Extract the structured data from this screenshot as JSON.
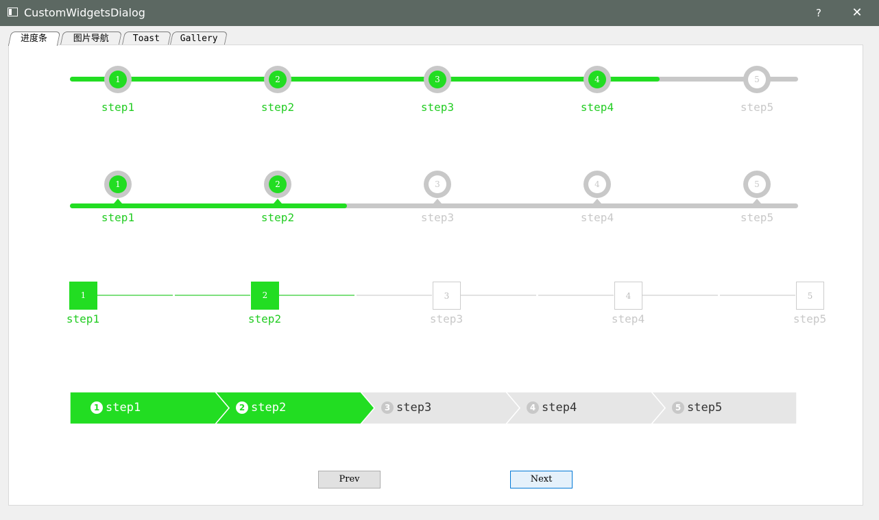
{
  "window": {
    "title": "CustomWidgetsDialog",
    "help_label": "?",
    "close_label": "✕"
  },
  "tabs": [
    {
      "label": "进度条",
      "active": true
    },
    {
      "label": "图片导航",
      "active": false
    },
    {
      "label": "Toast",
      "active": false
    },
    {
      "label": "Gallery",
      "active": false
    }
  ],
  "colors": {
    "active": "#22dd22",
    "inactive": "#c8c8c8"
  },
  "current_step": 4,
  "steppers": {
    "circle_top": {
      "progress": 0.81,
      "steps": [
        {
          "num": "1",
          "label": "step1",
          "done": true
        },
        {
          "num": "2",
          "label": "step2",
          "done": true
        },
        {
          "num": "3",
          "label": "step3",
          "done": true
        },
        {
          "num": "4",
          "label": "step4",
          "done": true
        },
        {
          "num": "5",
          "label": "step5",
          "done": false
        }
      ]
    },
    "circle_pointer": {
      "progress": 0.38,
      "steps": [
        {
          "num": "1",
          "label": "step1",
          "done": true
        },
        {
          "num": "2",
          "label": "step2",
          "done": true
        },
        {
          "num": "3",
          "label": "step3",
          "done": false
        },
        {
          "num": "4",
          "label": "step4",
          "done": false
        },
        {
          "num": "5",
          "label": "step5",
          "done": false
        }
      ]
    },
    "square": {
      "steps": [
        {
          "num": "1",
          "label": "step1",
          "done": true
        },
        {
          "num": "2",
          "label": "step2",
          "done": true
        },
        {
          "num": "3",
          "label": "step3",
          "done": false
        },
        {
          "num": "4",
          "label": "step4",
          "done": false
        },
        {
          "num": "5",
          "label": "step5",
          "done": false
        }
      ]
    },
    "arrow": {
      "steps": [
        {
          "num": "1",
          "label": "step1",
          "done": true
        },
        {
          "num": "2",
          "label": "step2",
          "done": true
        },
        {
          "num": "3",
          "label": "step3",
          "done": false
        },
        {
          "num": "4",
          "label": "step4",
          "done": false
        },
        {
          "num": "5",
          "label": "step5",
          "done": false
        }
      ]
    }
  },
  "buttons": {
    "prev": "Prev",
    "next": "Next"
  }
}
